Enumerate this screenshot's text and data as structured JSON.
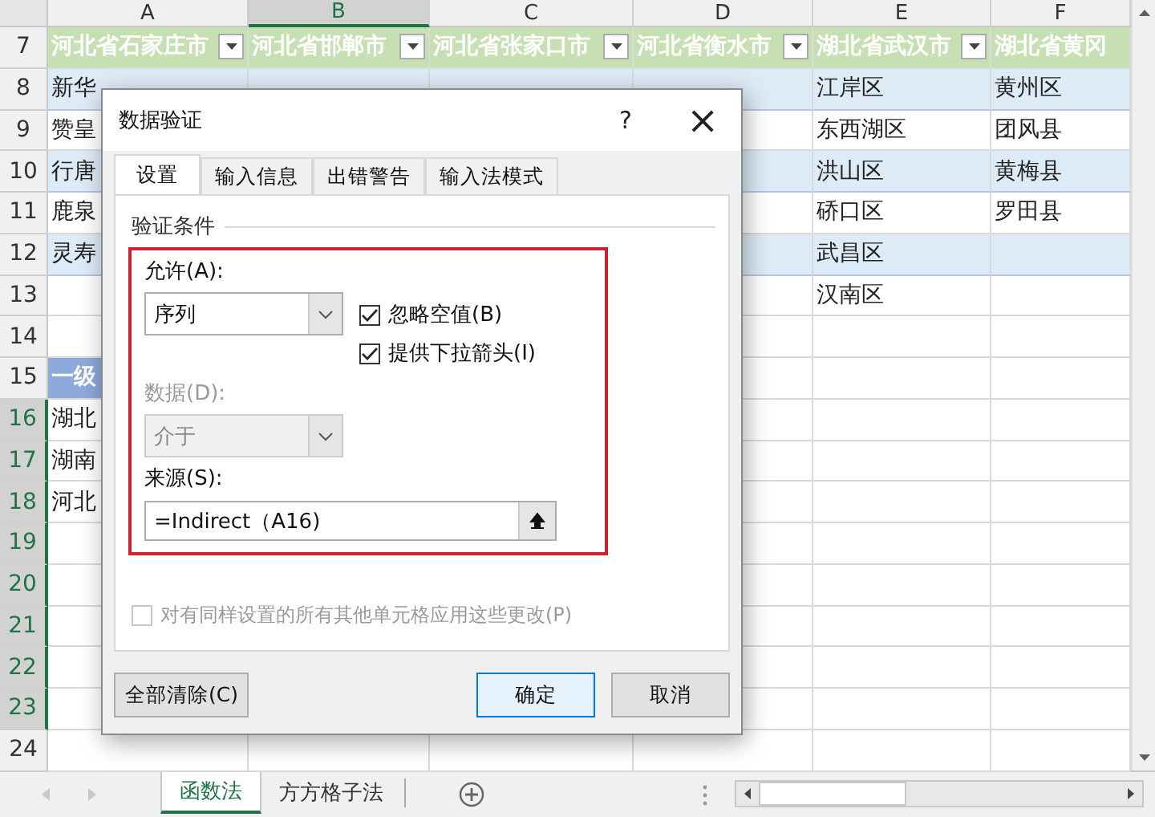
{
  "column_headers": [
    {
      "label": "A",
      "selected": false
    },
    {
      "label": "B",
      "selected": true
    },
    {
      "label": "C",
      "selected": false
    },
    {
      "label": "D",
      "selected": false
    },
    {
      "label": "E",
      "selected": false
    },
    {
      "label": "F",
      "selected": false
    }
  ],
  "rows": [
    {
      "number": "7",
      "selected": false,
      "kind": "table-header",
      "cells": [
        {
          "text": "河北省石家庄市",
          "filter": true
        },
        {
          "text": "河北省邯郸市",
          "filter": true
        },
        {
          "text": "河北省张家口市",
          "filter": true
        },
        {
          "text": "河北省衡水市",
          "filter": true
        },
        {
          "text": "湖北省武汉市",
          "filter": true
        },
        {
          "text": "湖北省黄冈",
          "filter": false
        }
      ]
    },
    {
      "number": "8",
      "selected": false,
      "kind": "band",
      "cells": [
        {
          "text": "新华"
        },
        {},
        {},
        {},
        {
          "text": "江岸区"
        },
        {
          "text": "黄州区"
        }
      ]
    },
    {
      "number": "9",
      "selected": false,
      "kind": "plain",
      "cells": [
        {
          "text": "赞皇"
        },
        {},
        {},
        {},
        {
          "text": "东西湖区"
        },
        {
          "text": "团风县"
        }
      ]
    },
    {
      "number": "10",
      "selected": false,
      "kind": "band",
      "cells": [
        {
          "text": "行唐"
        },
        {},
        {},
        {},
        {
          "text": "洪山区"
        },
        {
          "text": "黄梅县"
        }
      ]
    },
    {
      "number": "11",
      "selected": false,
      "kind": "plain",
      "cells": [
        {
          "text": "鹿泉"
        },
        {},
        {},
        {},
        {
          "text": "硚口区"
        },
        {
          "text": "罗田县"
        }
      ]
    },
    {
      "number": "12",
      "selected": false,
      "kind": "band",
      "cells": [
        {
          "text": "灵寿"
        },
        {},
        {},
        {},
        {
          "text": "武昌区"
        },
        {}
      ]
    },
    {
      "number": "13",
      "selected": false,
      "kind": "plain",
      "cells": [
        {},
        {},
        {},
        {},
        {
          "text": "汉南区"
        },
        {}
      ]
    },
    {
      "number": "14",
      "selected": false,
      "kind": "plain",
      "cells": []
    },
    {
      "number": "15",
      "selected": false,
      "kind": "plain",
      "cells": [
        {
          "text": "一级",
          "kind": "level-header"
        }
      ]
    },
    {
      "number": "16",
      "selected": true,
      "kind": "plain",
      "cells": [
        {
          "text": "湖北"
        }
      ]
    },
    {
      "number": "17",
      "selected": true,
      "kind": "plain",
      "cells": [
        {
          "text": "湖南"
        }
      ]
    },
    {
      "number": "18",
      "selected": true,
      "kind": "plain",
      "cells": [
        {
          "text": "河北"
        }
      ]
    },
    {
      "number": "19",
      "selected": true,
      "kind": "plain",
      "cells": []
    },
    {
      "number": "20",
      "selected": true,
      "kind": "plain",
      "cells": []
    },
    {
      "number": "21",
      "selected": true,
      "kind": "plain",
      "cells": []
    },
    {
      "number": "22",
      "selected": true,
      "kind": "plain",
      "cells": []
    },
    {
      "number": "23",
      "selected": true,
      "kind": "plain",
      "cells": []
    },
    {
      "number": "24",
      "selected": false,
      "kind": "plain",
      "cells": []
    }
  ],
  "dialog": {
    "title": "数据验证",
    "help": "?",
    "close": "×",
    "tabs": [
      {
        "label": "设置",
        "selected": true
      },
      {
        "label": "输入信息",
        "selected": false
      },
      {
        "label": "出错警告",
        "selected": false
      },
      {
        "label": "输入法模式",
        "selected": false
      }
    ],
    "group_label": "验证条件",
    "allow": {
      "label": "允许(A):",
      "value": "序列"
    },
    "data": {
      "label": "数据(D):",
      "value": "介于",
      "disabled": true
    },
    "options": [
      {
        "label": "忽略空值(B)",
        "checked": true
      },
      {
        "label": "提供下拉箭头(I)",
        "checked": true
      }
    ],
    "source": {
      "label": "来源(S):",
      "value": "=Indirect（A16)"
    },
    "apply_all": {
      "label": "对有同样设置的所有其他单元格应用这些更改(P)",
      "checked": false,
      "disabled": true
    },
    "buttons": [
      {
        "label": "全部清除(C)",
        "default": false
      },
      {
        "label": "确定",
        "default": true
      },
      {
        "label": "取消",
        "default": false
      }
    ]
  },
  "sheet_tabs": [
    {
      "label": "函数法",
      "selected": true
    },
    {
      "label": "方方格子法",
      "selected": false
    }
  ]
}
